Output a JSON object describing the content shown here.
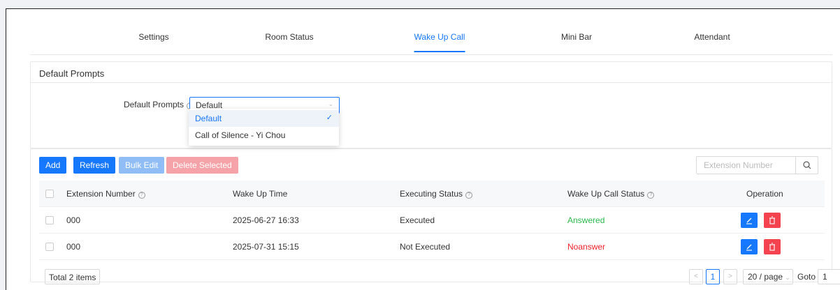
{
  "tabs": [
    {
      "label": "Settings"
    },
    {
      "label": "Room Status"
    },
    {
      "label": "Wake Up Call",
      "active": true
    },
    {
      "label": "Mini Bar"
    },
    {
      "label": "Attendant"
    }
  ],
  "prompts_card": {
    "title": "Default Prompts",
    "field_label": "Default Prompts",
    "selected_value": "Default",
    "options": [
      {
        "label": "Default",
        "selected": true
      },
      {
        "label": "Call of Silence - Yi Chou",
        "selected": false
      }
    ]
  },
  "toolbar": {
    "add_label": "Add",
    "refresh_label": "Refresh",
    "bulk_edit_label": "Bulk Edit",
    "delete_selected_label": "Delete Selected",
    "search_placeholder": "Extension Number"
  },
  "table": {
    "columns": [
      "Extension Number",
      "Wake Up Time",
      "Executing Status",
      "Wake Up Call Status",
      "Operation"
    ],
    "rows": [
      {
        "extension": "000",
        "time": "2025-06-27 16:33",
        "executing": "Executed",
        "status": "Answered"
      },
      {
        "extension": "000",
        "time": "2025-07-31 15:15",
        "executing": "Not Executed",
        "status": "Noanswer"
      }
    ]
  },
  "pagination": {
    "total_label": "Total 2 items",
    "current_page": "1",
    "page_size": "20 / page",
    "goto_label": "Goto",
    "goto_value": "1"
  },
  "colors": {
    "accent": "#1677ff",
    "success": "#2db84d",
    "danger": "#f5222d"
  }
}
